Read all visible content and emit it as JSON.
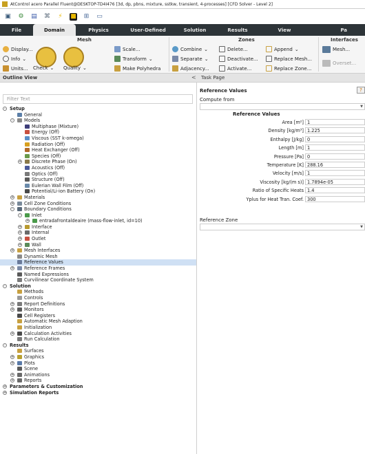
{
  "title": "AtControl acero Parallel Fluent@DESKTOP-TD4I476 [3d, dp, pbns, mixture, sstkw, transient, 4-processes] [CFD Solver - Level 2]",
  "colors": {
    "tabbar": "#2d3438",
    "ribbon": "#f5f5f5",
    "selection": "#cfe0f4"
  },
  "quick_icons": [
    "folder-icon",
    "gear-icon",
    "save-icon",
    "network-icon",
    "lightning-icon",
    "layout-icon",
    "grid-icon",
    "layout-alt-icon"
  ],
  "tabs": [
    "File",
    "Domain",
    "Physics",
    "User-Defined",
    "Solution",
    "Results",
    "View",
    "Pa"
  ],
  "ribbon": {
    "mesh": {
      "title": "Mesh",
      "display": "Display...",
      "info": "Info",
      "units": "Units...",
      "check": "Check",
      "quality": "Quality",
      "scale": "Scale...",
      "transform": "Transform",
      "polyhedra": "Make Polyhedra"
    },
    "zones": {
      "title": "Zones",
      "combine": "Combine",
      "separate": "Separate",
      "adjacency": "Adjacency...",
      "delete": "Delete...",
      "deactivate": "Deactivate...",
      "activate": "Activate...",
      "append": "Append",
      "replace_mesh": "Replace Mesh...",
      "replace_zone": "Replace Zone..."
    },
    "interfaces": {
      "title": "Interfaces",
      "mesh": "Mesh...",
      "overset": "Overset..."
    }
  },
  "outline": {
    "title": "Outline View",
    "collapse": "<",
    "filter_placeholder": "Filter Text"
  },
  "tree": [
    {
      "label": "Setup",
      "lvl": 0,
      "exp": "-",
      "bold": true
    },
    {
      "label": "General",
      "lvl": 1,
      "icon": "#5b7fa8"
    },
    {
      "label": "Models",
      "lvl": 1,
      "exp": "-",
      "icon": "#8a8a8a"
    },
    {
      "label": "Multiphase (Mixture)",
      "lvl": 2,
      "icon": "#3f3f7a"
    },
    {
      "label": "Energy (Off)",
      "lvl": 2,
      "icon": "#c85040"
    },
    {
      "label": "Viscous (SST k-omega)",
      "lvl": 2,
      "icon": "#5a8fc8"
    },
    {
      "label": "Radiation (Off)",
      "lvl": 2,
      "icon": "#d8a020"
    },
    {
      "label": "Heat Exchanger (Off)",
      "lvl": 2,
      "icon": "#b06a2a"
    },
    {
      "label": "Species (Off)",
      "lvl": 2,
      "icon": "#6a9a4a"
    },
    {
      "label": "Discrete Phase (On)",
      "lvl": 2,
      "exp": "+",
      "icon": "#8a7a4a"
    },
    {
      "label": "Acoustics (Off)",
      "lvl": 2,
      "icon": "#4a5a9a"
    },
    {
      "label": "Optics (Off)",
      "lvl": 2,
      "icon": "#7a7a7a"
    },
    {
      "label": "Structure (Off)",
      "lvl": 2,
      "icon": "#5a5a5a"
    },
    {
      "label": "Eulerian Wall Film (Off)",
      "lvl": 2,
      "icon": "#6a8aaa"
    },
    {
      "label": "Potential/Li-ion Battery (On)",
      "lvl": 2,
      "icon": "#4a4a4a"
    },
    {
      "label": "Materials",
      "lvl": 1,
      "exp": "+",
      "icon": "#c8a040"
    },
    {
      "label": "Cell Zone Conditions",
      "lvl": 1,
      "exp": "+",
      "icon": "#7a8a9a"
    },
    {
      "label": "Boundary Conditions",
      "lvl": 1,
      "exp": "-",
      "icon": "#5a6a7a"
    },
    {
      "label": "Inlet",
      "lvl": 2,
      "exp": "-",
      "icon": "#4a9a4a"
    },
    {
      "label": "entradafrontaldeaire (mass-flow-inlet, id=10)",
      "lvl": 3,
      "exp": "+",
      "icon": "#4a9a4a"
    },
    {
      "label": "Interface",
      "lvl": 2,
      "exp": "+",
      "icon": "#b89a30"
    },
    {
      "label": "Internal",
      "lvl": 2,
      "exp": "+",
      "icon": "#6a6a6a"
    },
    {
      "label": "Outlet",
      "lvl": 2,
      "exp": "+",
      "icon": "#c85040"
    },
    {
      "label": "Wall",
      "lvl": 2,
      "exp": "+",
      "icon": "#5a8a5a"
    },
    {
      "label": "Mesh Interfaces",
      "lvl": 1,
      "exp": "+",
      "icon": "#c8a040"
    },
    {
      "label": "Dynamic Mesh",
      "lvl": 1,
      "icon": "#8a8a8a"
    },
    {
      "label": "Reference Values",
      "lvl": 1,
      "icon": "#6a7a9a",
      "sel": true
    },
    {
      "label": "Reference Frames",
      "lvl": 1,
      "exp": "+",
      "icon": "#7a8aa8"
    },
    {
      "label": "Named Expressions",
      "lvl": 1,
      "icon": "#5a5a5a"
    },
    {
      "label": "Curvilinear Coordinate System",
      "lvl": 1,
      "icon": "#7a7a7a"
    },
    {
      "label": "Solution",
      "lvl": 0,
      "exp": "-",
      "bold": true
    },
    {
      "label": "Methods",
      "lvl": 1,
      "icon": "#c8a040"
    },
    {
      "label": "Controls",
      "lvl": 1,
      "icon": "#9a9a9a"
    },
    {
      "label": "Report Definitions",
      "lvl": 1,
      "exp": "+",
      "icon": "#7a7a7a"
    },
    {
      "label": "Monitors",
      "lvl": 1,
      "exp": "+",
      "icon": "#5a5a5a"
    },
    {
      "label": "Cell Registers",
      "lvl": 1,
      "icon": "#4a4a4a"
    },
    {
      "label": "Automatic Mesh Adaption",
      "lvl": 1,
      "icon": "#c8a040"
    },
    {
      "label": "Initialization",
      "lvl": 1,
      "icon": "#c8a040"
    },
    {
      "label": "Calculation Activities",
      "lvl": 1,
      "exp": "+",
      "icon": "#4a4a4a"
    },
    {
      "label": "Run Calculation",
      "lvl": 1,
      "icon": "#7a7a7a"
    },
    {
      "label": "Results",
      "lvl": 0,
      "exp": "-",
      "bold": true
    },
    {
      "label": "Surfaces",
      "lvl": 1,
      "icon": "#c8a040"
    },
    {
      "label": "Graphics",
      "lvl": 1,
      "exp": "+",
      "icon": "#b8a030"
    },
    {
      "label": "Plots",
      "lvl": 1,
      "exp": "+",
      "icon": "#5a7aa8"
    },
    {
      "label": "Scene",
      "lvl": 1,
      "icon": "#5a5a5a"
    },
    {
      "label": "Animations",
      "lvl": 1,
      "exp": "+",
      "icon": "#6a6a6a"
    },
    {
      "label": "Reports",
      "lvl": 1,
      "exp": "+",
      "icon": "#6a6a6a"
    },
    {
      "label": "Parameters & Customization",
      "lvl": 0,
      "exp": "+",
      "bold": true
    },
    {
      "label": "Simulation Reports",
      "lvl": 0,
      "exp": "+",
      "bold": true
    }
  ],
  "task": {
    "header": "Task Page",
    "title": "Reference Values",
    "help": "?",
    "compute_from": "Compute from",
    "compute_from_value": "",
    "ref_title": "Reference Values",
    "ref_zone": "Reference Zone",
    "ref_zone_value": "",
    "values": [
      {
        "label": "Area [m²]",
        "value": "1"
      },
      {
        "label": "Density [kg/m³]",
        "value": "1.225"
      },
      {
        "label": "Enthalpy [J/kg]",
        "value": "0"
      },
      {
        "label": "Length [m]",
        "value": "1"
      },
      {
        "label": "Pressure [Pa]",
        "value": "0"
      },
      {
        "label": "Temperature [K]",
        "value": "288.16"
      },
      {
        "label": "Velocity [m/s]",
        "value": "1"
      },
      {
        "label": "Viscosity [kg/(m s)]",
        "value": "1.7894e-05"
      },
      {
        "label": "Ratio of Specific Heats",
        "value": "1.4"
      },
      {
        "label": "Yplus for Heat Tran. Coef.",
        "value": "300"
      }
    ]
  }
}
